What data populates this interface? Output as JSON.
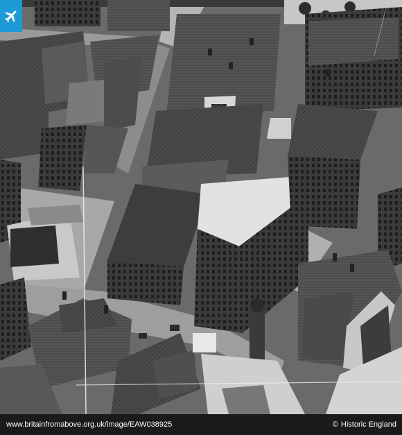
{
  "photo": {
    "kind": "black-and-white aerial photograph",
    "alt_icon": "airplane-icon"
  },
  "footer": {
    "url": "www.britainfromabove.org.uk/image/EAW038925",
    "copyright_symbol": "©",
    "owner": "Historic England"
  },
  "colors": {
    "badge": "#1e9ad6",
    "footer_bg": "#1a1a1a",
    "footer_text": "#ffffff"
  }
}
